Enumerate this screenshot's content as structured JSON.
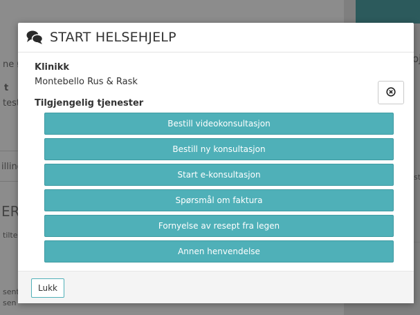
{
  "background": {
    "left_texts": [
      "ne Ø",
      "t",
      "teste",
      "illing",
      "ER",
      "tilte",
      "sente",
      "sen"
    ],
    "right_texts": [
      "oj",
      "st"
    ],
    "accent_color": "#2c5a5c"
  },
  "modal": {
    "title": "START HELSEHJELP",
    "icon": "chat-bubbles-icon",
    "clinic_label": "Klinikk",
    "clinic_value": "Montebello Rus & Rask",
    "close_icon": "close-circle-icon",
    "services_label": "Tilgjengelig tjenester",
    "services": [
      "Bestill videokonsultasjon",
      "Bestill ny konsultasjon",
      "Start e-konsultasjon",
      "Spørsmål om faktura",
      "Fornyelse av resept fra legen",
      "Annen henvendelse"
    ],
    "footer_button": "Lukk",
    "button_color": "#4fb0b8"
  }
}
